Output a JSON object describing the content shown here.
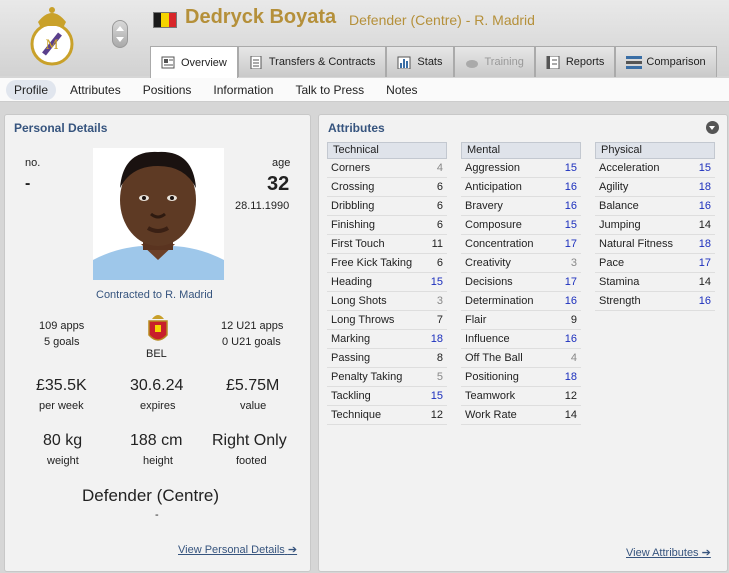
{
  "header": {
    "player_name": "Dedryck Boyata",
    "role_club": "Defender (Centre) - R. Madrid",
    "flag_colors": [
      "#1a1a1a",
      "#f5d400",
      "#d8262a"
    ],
    "name_color": "#b5903a"
  },
  "tabs": [
    {
      "label": "Overview",
      "icon": "overview-icon"
    },
    {
      "label": "Transfers & Contracts",
      "icon": "document-icon"
    },
    {
      "label": "Stats",
      "icon": "stats-icon"
    },
    {
      "label": "Training",
      "icon": "training-icon"
    },
    {
      "label": "Reports",
      "icon": "reports-icon"
    },
    {
      "label": "Comparison",
      "icon": "comparison-icon"
    }
  ],
  "subnav": [
    "Profile",
    "Attributes",
    "Positions",
    "Information",
    "Talk to Press",
    "Notes"
  ],
  "personal": {
    "title": "Personal Details",
    "no_label": "no.",
    "no_value": "-",
    "age_label": "age",
    "age_value": "32",
    "dob": "28.11.1990",
    "contract": "Contracted to R. Madrid",
    "apps": "109 apps",
    "goals": "5 goals",
    "nation": "BEL",
    "u21_apps": "12 U21 apps",
    "u21_goals": "0 U21 goals",
    "wage": "£35.5K",
    "wage_label": "per week",
    "expires": "30.6.24",
    "expires_label": "expires",
    "value": "£5.75M",
    "value_label": "value",
    "weight": "80 kg",
    "weight_label": "weight",
    "height": "188 cm",
    "height_label": "height",
    "footed": "Right Only",
    "footed_label": "footed",
    "position": "Defender (Centre)",
    "position_sub": "-",
    "link": "View Personal Details"
  },
  "attributes": {
    "title": "Attributes",
    "link": "View Attributes",
    "technical": {
      "label": "Technical",
      "items": [
        {
          "name": "Corners",
          "value": "4"
        },
        {
          "name": "Crossing",
          "value": "6"
        },
        {
          "name": "Dribbling",
          "value": "6"
        },
        {
          "name": "Finishing",
          "value": "6"
        },
        {
          "name": "First Touch",
          "value": "11"
        },
        {
          "name": "Free Kick Taking",
          "value": "6"
        },
        {
          "name": "Heading",
          "value": "15"
        },
        {
          "name": "Long Shots",
          "value": "3"
        },
        {
          "name": "Long Throws",
          "value": "7"
        },
        {
          "name": "Marking",
          "value": "18"
        },
        {
          "name": "Passing",
          "value": "8"
        },
        {
          "name": "Penalty Taking",
          "value": "5"
        },
        {
          "name": "Tackling",
          "value": "15"
        },
        {
          "name": "Technique",
          "value": "12"
        }
      ]
    },
    "mental": {
      "label": "Mental",
      "items": [
        {
          "name": "Aggression",
          "value": "15"
        },
        {
          "name": "Anticipation",
          "value": "16"
        },
        {
          "name": "Bravery",
          "value": "16"
        },
        {
          "name": "Composure",
          "value": "15"
        },
        {
          "name": "Concentration",
          "value": "17"
        },
        {
          "name": "Creativity",
          "value": "3"
        },
        {
          "name": "Decisions",
          "value": "17"
        },
        {
          "name": "Determination",
          "value": "16"
        },
        {
          "name": "Flair",
          "value": "9"
        },
        {
          "name": "Influence",
          "value": "16"
        },
        {
          "name": "Off The Ball",
          "value": "4"
        },
        {
          "name": "Positioning",
          "value": "18"
        },
        {
          "name": "Teamwork",
          "value": "12"
        },
        {
          "name": "Work Rate",
          "value": "14"
        }
      ]
    },
    "physical": {
      "label": "Physical",
      "items": [
        {
          "name": "Acceleration",
          "value": "15"
        },
        {
          "name": "Agility",
          "value": "18"
        },
        {
          "name": "Balance",
          "value": "16"
        },
        {
          "name": "Jumping",
          "value": "14"
        },
        {
          "name": "Natural Fitness",
          "value": "18"
        },
        {
          "name": "Pace",
          "value": "17"
        },
        {
          "name": "Stamina",
          "value": "14"
        },
        {
          "name": "Strength",
          "value": "16"
        }
      ]
    }
  }
}
